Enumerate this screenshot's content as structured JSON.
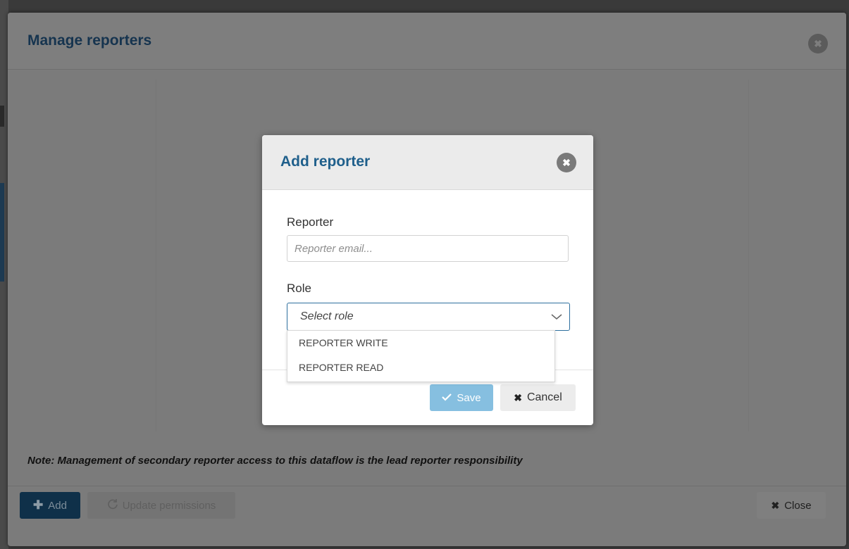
{
  "manage_dialog": {
    "title": "Manage reporters",
    "note": "Note: Management of secondary reporter access to this dataflow is the lead reporter responsibility",
    "footer": {
      "add_label": "Add",
      "update_label": "Update permissions",
      "close_label": "Close"
    }
  },
  "add_dialog": {
    "title": "Add reporter",
    "reporter_label": "Reporter",
    "reporter_placeholder": "Reporter email...",
    "role_label": "Role",
    "role_placeholder": "Select role",
    "role_options": [
      "REPORTER WRITE",
      "REPORTER READ"
    ],
    "save_label": "Save",
    "cancel_label": "Cancel"
  },
  "colors": {
    "title_blue": "#1f5f8b",
    "primary_dark": "#0f3049",
    "save_blue": "#86bfe0"
  },
  "icons": {
    "close": "times-circle-icon",
    "add": "plus-icon",
    "update": "refresh-icon",
    "save": "check-icon",
    "cancel": "times-icon",
    "select": "chevron-down-icon"
  }
}
